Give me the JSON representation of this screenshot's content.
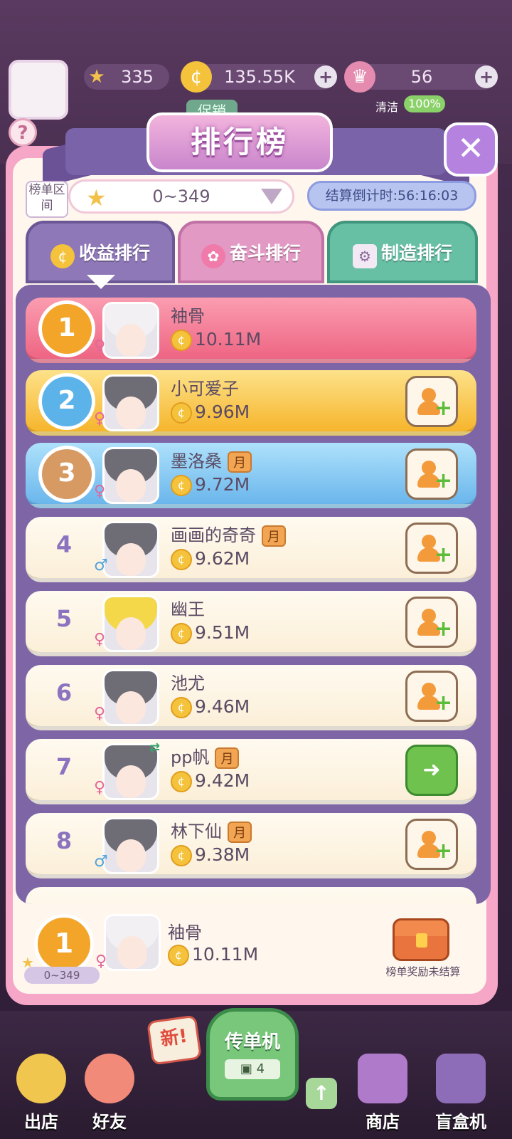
{
  "hud": {
    "stars": "335",
    "coins": "135.55K",
    "crowns": "56",
    "clean_label": "清洁",
    "clean_value": "100%",
    "promo_label": "促销"
  },
  "panel": {
    "title": "排行榜",
    "range_label": "榜单区间",
    "range_value": "0~349",
    "timer": "结算倒计时:56:16:03"
  },
  "tabs": [
    {
      "label": "收益排行"
    },
    {
      "label": "奋斗排行"
    },
    {
      "label": "制造排行"
    }
  ],
  "ranking": [
    {
      "rank": "1",
      "name": "袖骨",
      "score": "10.11M",
      "gender": "♀",
      "month": ""
    },
    {
      "rank": "2",
      "name": "小可爱子",
      "score": "9.96M",
      "gender": "♀",
      "month": ""
    },
    {
      "rank": "3",
      "name": "墨洛桑",
      "score": "9.72M",
      "gender": "♀",
      "month": "月"
    },
    {
      "rank": "4",
      "name": "画画的奇奇",
      "score": "9.62M",
      "gender": "♂",
      "month": "月"
    },
    {
      "rank": "5",
      "name": "幽王",
      "score": "9.51M",
      "gender": "♀",
      "month": ""
    },
    {
      "rank": "6",
      "name": "池尤",
      "score": "9.46M",
      "gender": "♀",
      "month": ""
    },
    {
      "rank": "7",
      "name": "pp帆",
      "score": "9.42M",
      "gender": "♀",
      "month": "月"
    },
    {
      "rank": "8",
      "name": "林下仙",
      "score": "9.38M",
      "gender": "♂",
      "month": "月"
    }
  ],
  "my_rank": {
    "rank": "1",
    "range": "0~349",
    "name": "袖骨",
    "score": "10.11M",
    "gender": "♀",
    "reward_text": "榜单奖励未结算"
  },
  "bottom": {
    "store": "出店",
    "friends": "好友",
    "flyer_title": "传单机",
    "flyer_count": "4",
    "new_badge": "新!",
    "shop": "商店",
    "blindbox": "盲盒机"
  }
}
